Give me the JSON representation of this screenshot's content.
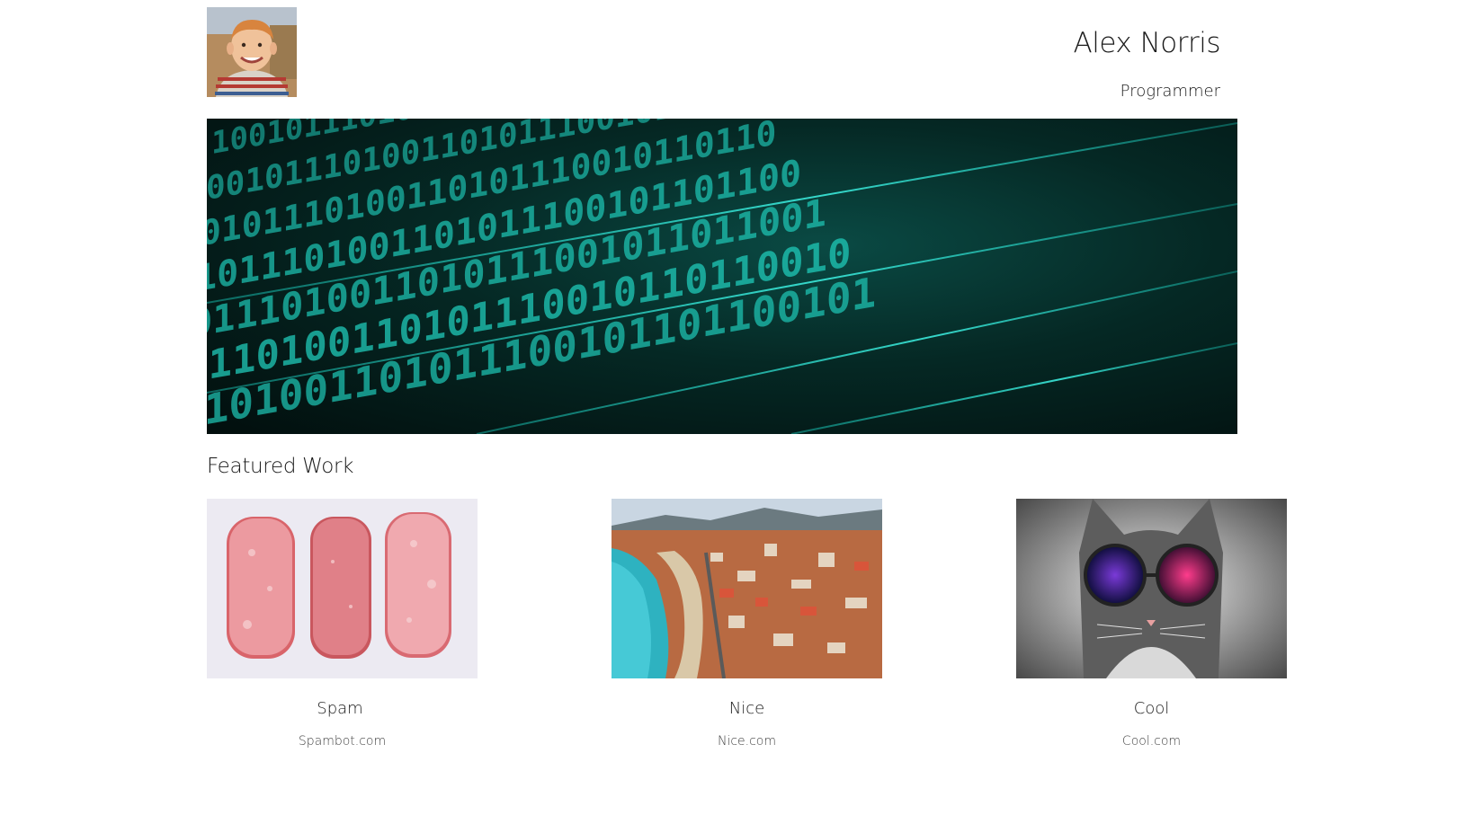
{
  "header": {
    "name": "Alex Norris",
    "role": "Programmer"
  },
  "icons": {
    "avatar": "profile-photo",
    "hero": "binary-code-banner"
  },
  "featured": {
    "title": "Featured Work",
    "items": [
      {
        "title": "Spam",
        "link": "Spambot.com",
        "image": "spam-slices"
      },
      {
        "title": "Nice",
        "link": "Nice.com",
        "image": "nice-coastline"
      },
      {
        "title": "Cool",
        "link": "Cool.com",
        "image": "cat-with-galaxy-glasses"
      }
    ]
  },
  "colors": {
    "hero_cyan": "#19d6c6",
    "hero_dark": "#031a18"
  }
}
